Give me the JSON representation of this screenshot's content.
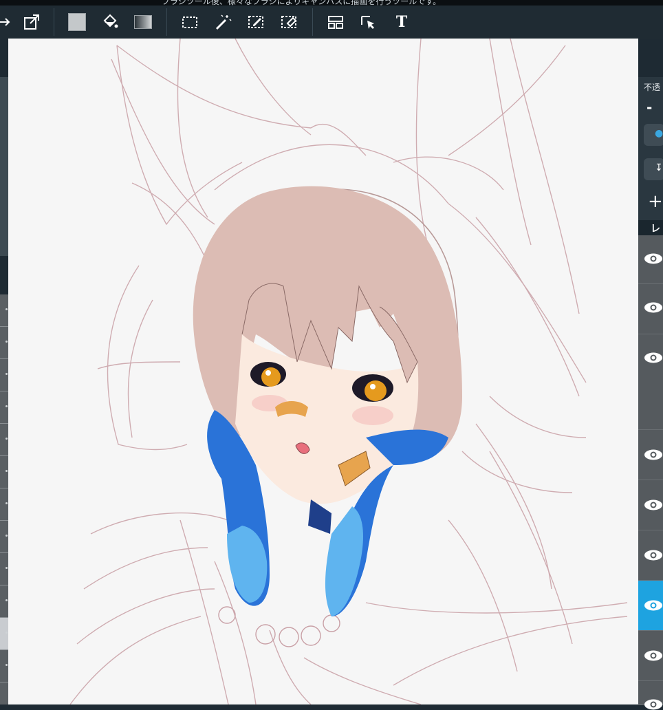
{
  "hint": {
    "text": "ブラシツール後、様々なブラシによりキャンバスに描画を行うツールです。"
  },
  "toolbar": {
    "items": [
      {
        "name": "transform-icon"
      },
      {
        "name": "export-icon"
      },
      {
        "name": "fill-color-icon"
      },
      {
        "name": "bucket-icon"
      },
      {
        "name": "gradient-icon"
      },
      {
        "name": "select-rect-icon"
      },
      {
        "name": "magic-wand-icon"
      },
      {
        "name": "select-pen-icon"
      },
      {
        "name": "select-eraser-icon"
      },
      {
        "name": "layout-icon"
      },
      {
        "name": "move-icon"
      },
      {
        "name": "text-icon",
        "label": "T"
      }
    ]
  },
  "right_panel": {
    "opacity_label": "不透",
    "opacity_minus": "-",
    "add_label": "+",
    "layer_tab": "レ",
    "layers_active_index": 6
  },
  "colors": {
    "accent": "#1ea3e0",
    "hair": "#dcbcb4",
    "braid": "#2a73d8",
    "sketch": "#c79aa0"
  }
}
